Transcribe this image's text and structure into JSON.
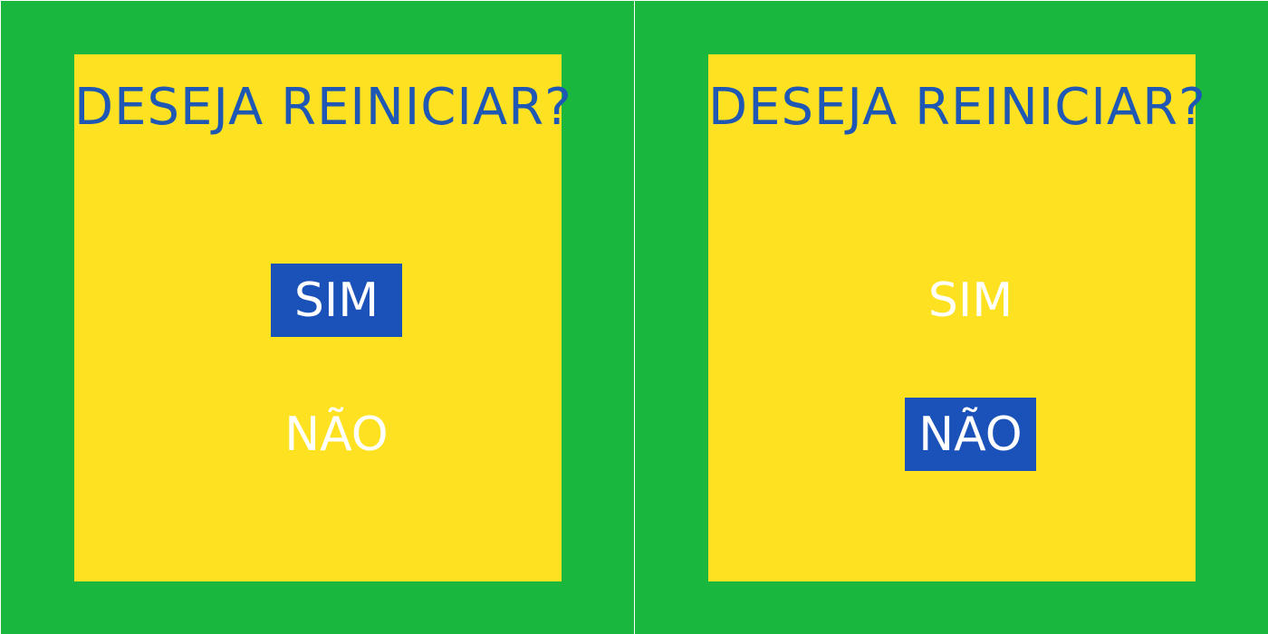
{
  "screens": [
    {
      "dialog": {
        "title": "DESEJA REINICIAR?",
        "yes_label": "SIM",
        "no_label": "NÃO",
        "selected": "yes"
      }
    },
    {
      "dialog": {
        "title": "DESEJA REINICIAR?",
        "yes_label": "SIM",
        "no_label": "NÃO",
        "selected": "no"
      }
    }
  ],
  "colors": {
    "background": "#19b73e",
    "dialog": "#fee222",
    "title_text": "#1f57b5",
    "option_text": "#ffffff",
    "selection_highlight": "#1a52b9"
  }
}
